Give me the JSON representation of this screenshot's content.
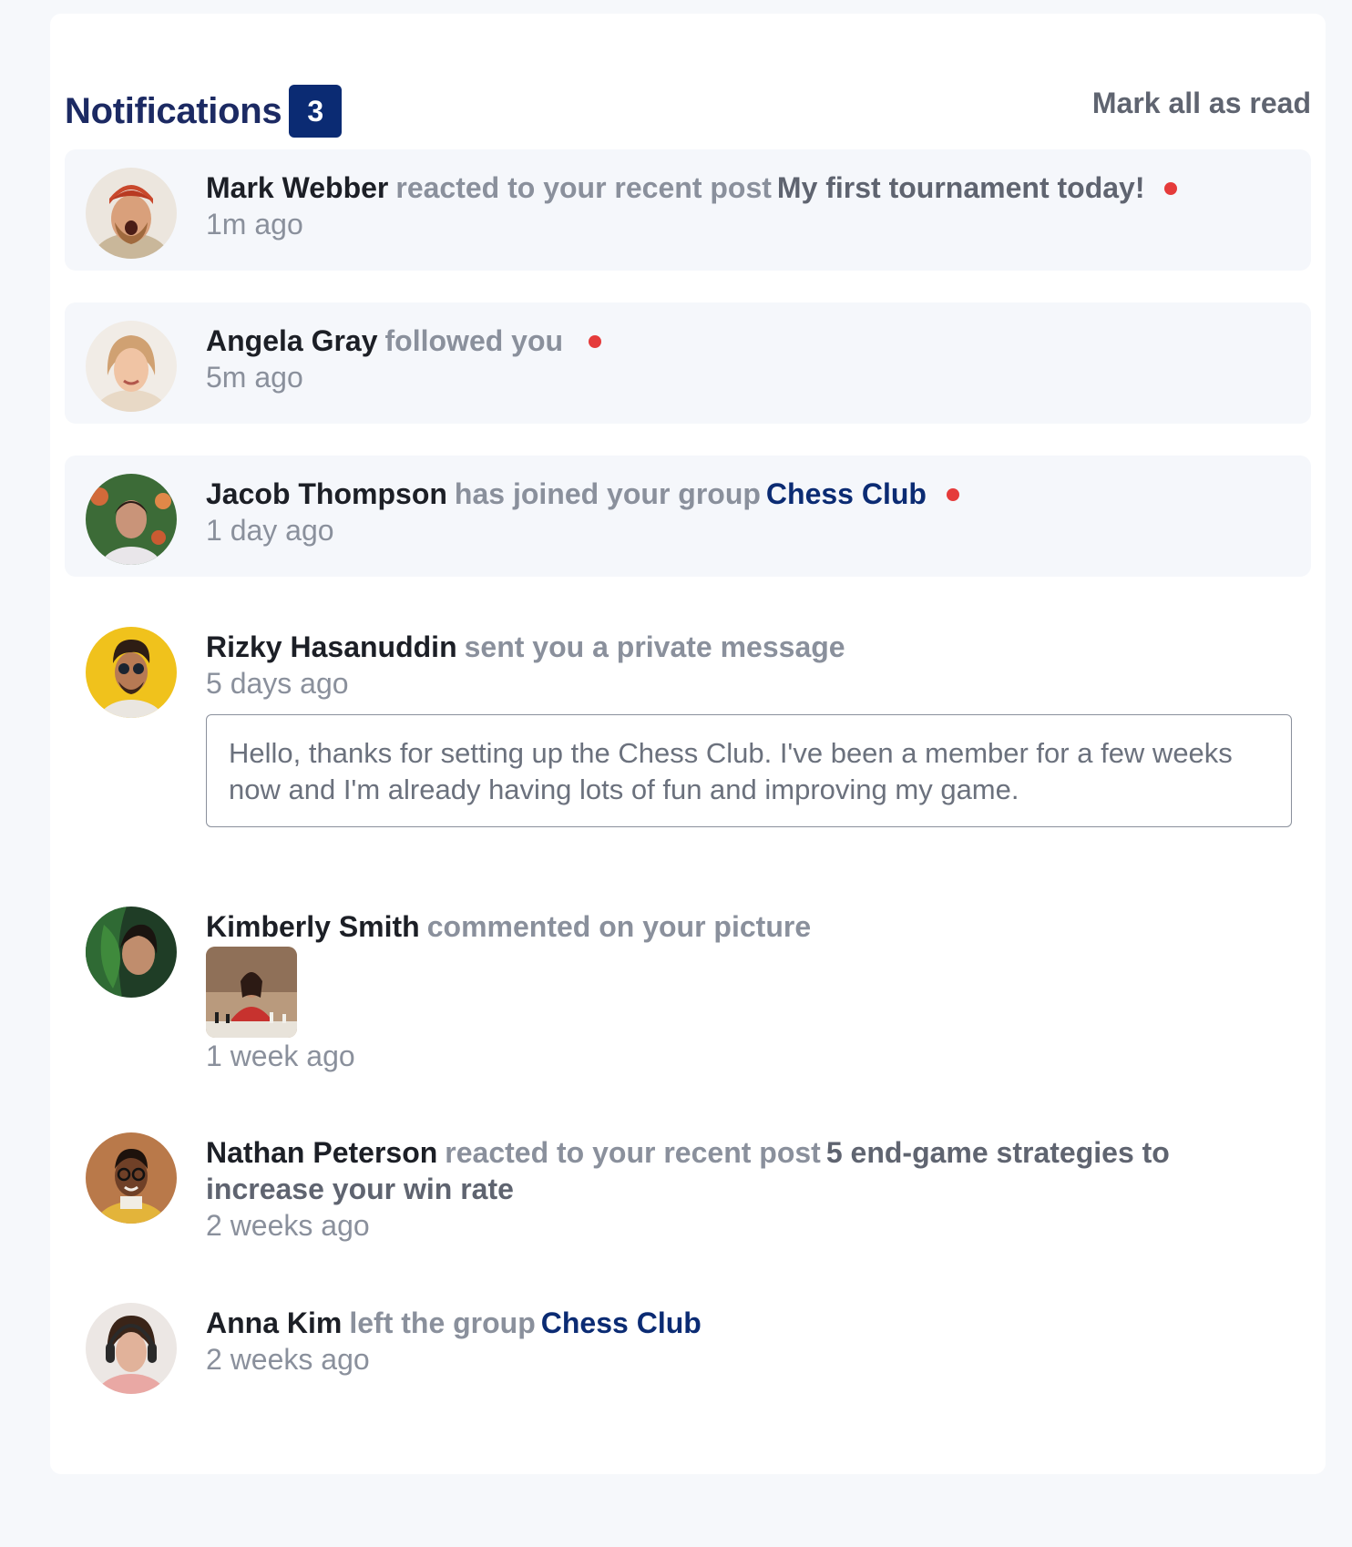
{
  "header": {
    "title": "Notifications",
    "unread_count": "3",
    "mark_all_label": "Mark all as read"
  },
  "notifications": [
    {
      "name": "Mark Webber",
      "action": "reacted to your recent post",
      "target": "My first tournament today!",
      "target_type": "post",
      "time": "1m ago",
      "unread": true
    },
    {
      "name": "Angela Gray",
      "action": "followed you",
      "target": "",
      "target_type": "",
      "time": "5m ago",
      "unread": true
    },
    {
      "name": "Jacob Thompson",
      "action": "has joined your group",
      "target": "Chess Club",
      "target_type": "group",
      "time": "1 day ago",
      "unread": true
    },
    {
      "name": "Rizky Hasanuddin",
      "action": "sent you a private message",
      "target": "",
      "target_type": "",
      "time": "5 days ago",
      "unread": false,
      "message": "Hello, thanks for setting up the Chess Club. I've been a member for a few weeks now and I'm already having lots of fun and improving my game."
    },
    {
      "name": "Kimberly Smith",
      "action": "commented on your picture",
      "target": "",
      "target_type": "",
      "time": "1 week ago",
      "unread": false
    },
    {
      "name": "Nathan Peterson",
      "action": "reacted to your recent post",
      "target": "5 end-game strategies to increase your win rate",
      "target_type": "post",
      "time": "2 weeks ago",
      "unread": false
    },
    {
      "name": "Anna Kim",
      "action": "left the group",
      "target": "Chess Club",
      "target_type": "group",
      "time": "2 weeks ago",
      "unread": false
    }
  ],
  "colors": {
    "accent": "#0b2b73",
    "unread_dot": "#e53b3b",
    "unread_bg": "#f5f7fb"
  }
}
